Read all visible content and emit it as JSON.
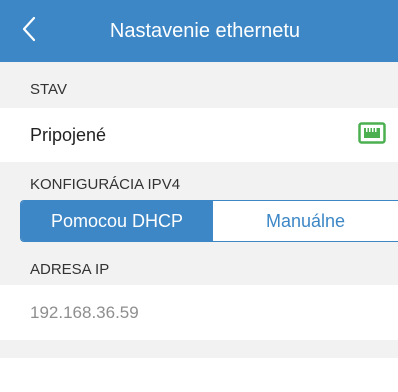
{
  "header": {
    "title": "Nastavenie ethernetu",
    "back_icon": "chevron-left-icon"
  },
  "status_section": {
    "heading": "STAV",
    "value": "Pripojené",
    "status_icon": "ethernet-port-icon",
    "status_color": "#4caf50"
  },
  "ipv4_section": {
    "heading": "KONFIGURÁCIA IPV4",
    "options": [
      "Pomocou DHCP",
      "Manuálne"
    ],
    "selected": "Pomocou DHCP"
  },
  "ip_section": {
    "heading": "ADRESA IP",
    "value": "192.168.36.59"
  },
  "colors": {
    "accent": "#3d87c6",
    "section_bg": "#f2f2f2"
  }
}
